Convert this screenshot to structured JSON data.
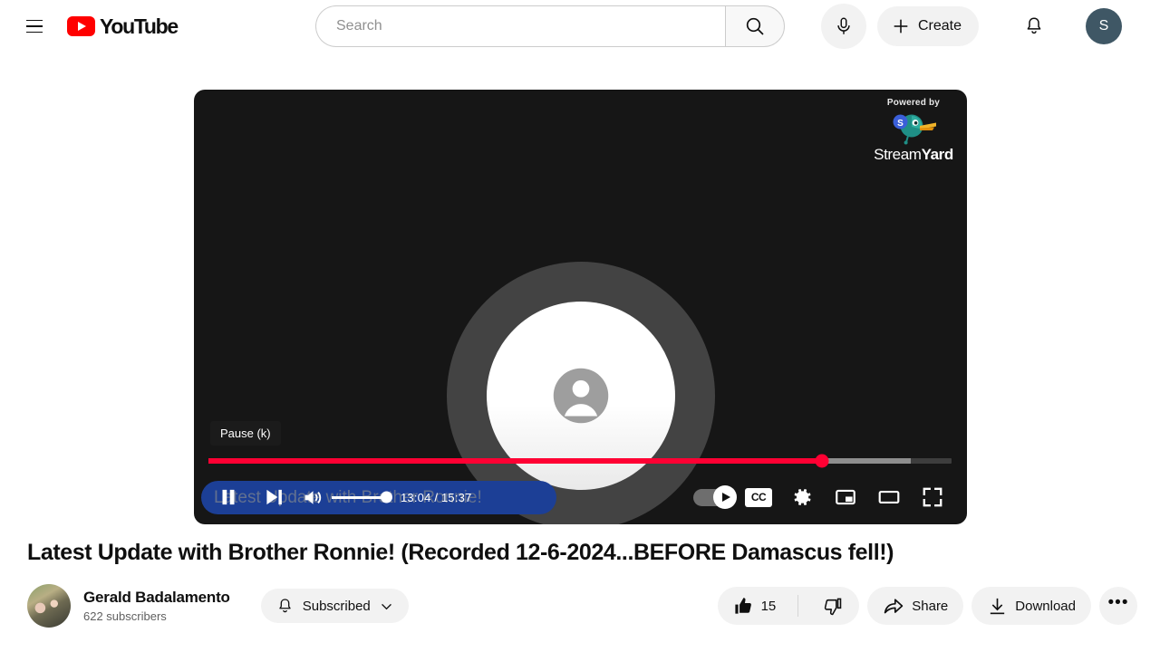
{
  "header": {
    "menu_icon": "hamburger-icon",
    "logo_text": "YouTube",
    "search": {
      "placeholder": "Search",
      "value": "",
      "button_icon": "search-icon"
    },
    "mic_icon": "microphone-icon",
    "create_label": "Create",
    "create_icon": "plus-icon",
    "notifications_icon": "bell-icon",
    "avatar_initial": "S"
  },
  "player": {
    "watermark": {
      "powered_by": "Powered by",
      "brand_first": "Stream",
      "brand_second": "Yard"
    },
    "tooltip": "Pause (k)",
    "selection_text": "Latest Update with Brother Ronnie!",
    "selection_color": "#1c3f96",
    "avatar_icon": "person-placeholder-icon",
    "controls": {
      "pause_icon": "pause-icon",
      "next_icon": "next-video-icon",
      "volume_icon": "volume-high-icon",
      "volume_percent": 100,
      "time_display": "13:04 / 15:37",
      "current_time": "13:04",
      "duration": "15:37",
      "autoplay_label": "autoplay-toggle",
      "autoplay_on": true,
      "cc_label": "CC",
      "settings_icon": "gear-icon",
      "miniplayer_icon": "miniplayer-icon",
      "theater_icon": "theater-mode-icon",
      "fullscreen_icon": "fullscreen-icon"
    },
    "progress": {
      "played_percent": 82.5,
      "buffered_percent": 94.5,
      "played_color": "#ff0033",
      "buffer_color": "#8e8e8e",
      "track_color": "#3d3d3d"
    }
  },
  "video": {
    "title": "Latest Update with Brother Ronnie! (Recorded 12-6-2024...BEFORE Damascus fell!)",
    "channel_name": "Gerald Badalamento",
    "subscriber_count": "622 subscribers",
    "subscribe_label": "Subscribed",
    "subscribe_bell_icon": "bell-icon",
    "subscribe_chevron_icon": "chevron-down-icon",
    "like_count": "15",
    "like_icon": "thumbs-up-filled-icon",
    "dislike_icon": "thumbs-down-icon",
    "share_label": "Share",
    "share_icon": "share-arrow-icon",
    "download_label": "Download",
    "download_icon": "download-icon",
    "more_label": "•••"
  }
}
